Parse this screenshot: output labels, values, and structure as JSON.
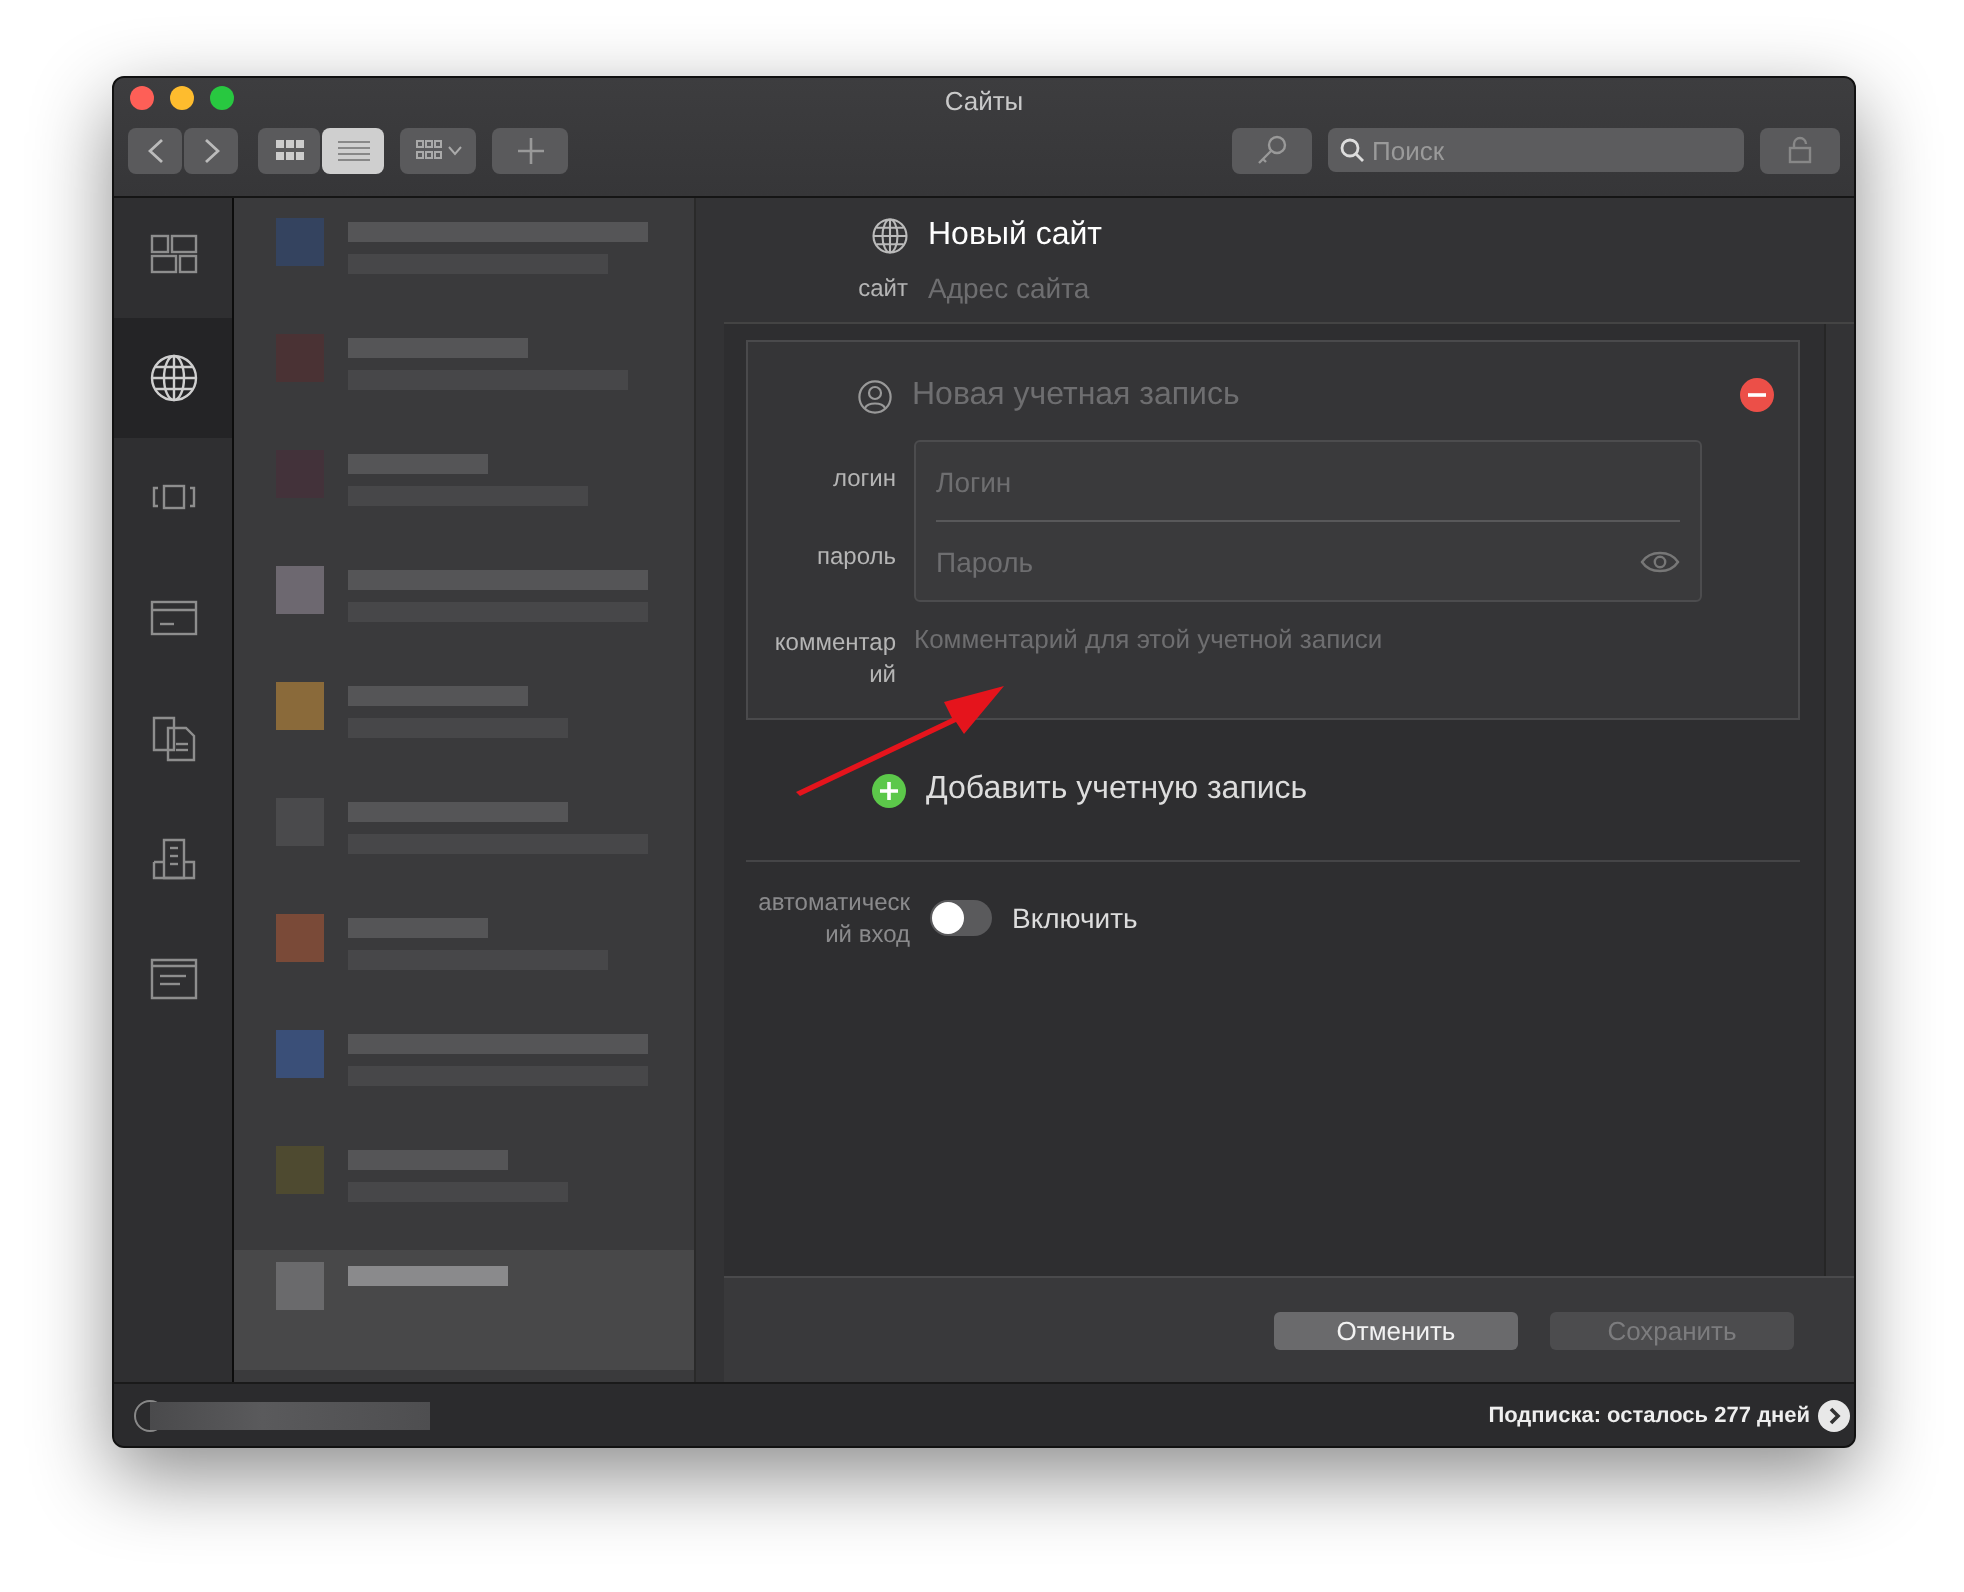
{
  "window": {
    "title": "Сайты"
  },
  "toolbar": {
    "view_modes": [
      {
        "kind": "grid",
        "selected": false
      },
      {
        "kind": "list",
        "selected": true
      }
    ],
    "search": {
      "placeholder": "Поиск"
    }
  },
  "sidebar": {
    "items": [
      {
        "kind": "dashboard",
        "selected": false
      },
      {
        "kind": "globe",
        "selected": true
      },
      {
        "kind": "app",
        "selected": false
      },
      {
        "kind": "card",
        "selected": false
      },
      {
        "kind": "documents",
        "selected": false
      },
      {
        "kind": "building",
        "selected": false
      },
      {
        "kind": "note",
        "selected": false
      }
    ]
  },
  "list": {
    "rows": [
      {
        "color": "#34435f",
        "selected": false
      },
      {
        "color": "#4a3234",
        "selected": false
      },
      {
        "color": "#43323a",
        "selected": false
      },
      {
        "color": "#6d6870",
        "selected": false
      },
      {
        "color": "#8a6a3a",
        "selected": false
      },
      {
        "color": "#4a4a4c",
        "selected": false
      },
      {
        "color": "#7a4a38",
        "selected": false
      },
      {
        "color": "#3a4f78",
        "selected": false
      },
      {
        "color": "#4e4a30",
        "selected": false
      },
      {
        "color": "#6a6a6c",
        "selected": true
      }
    ]
  },
  "detail": {
    "title": "Новый сайт",
    "site": {
      "label": "сайт",
      "placeholder": "Адрес сайта"
    },
    "account": {
      "name_placeholder": "Новая учетная запись",
      "login": {
        "label": "логин",
        "placeholder": "Логин"
      },
      "password": {
        "label": "пароль",
        "placeholder": "Пароль"
      },
      "comment": {
        "label": "комментарий",
        "placeholder": "Комментарий для этой учетной записи"
      }
    },
    "add_account": "Добавить учетную запись",
    "autologin": {
      "label": "автоматический вход",
      "toggle_label": "Включить",
      "on": false
    },
    "buttons": [
      {
        "label": "Отменить",
        "disabled": false
      },
      {
        "label": "Сохранить",
        "disabled": true
      }
    ]
  },
  "status_bar": {
    "subscription": "Подписка: осталось 277 дней"
  }
}
